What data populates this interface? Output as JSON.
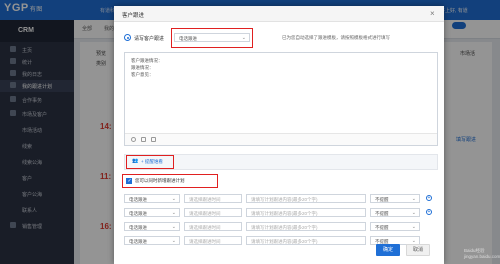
{
  "app": {
    "logo": "YGP",
    "logo_sub": "有图",
    "brand_note": "有道科技让营销变简单",
    "top_right": "牛上好, 有道"
  },
  "sidebar": {
    "title": "CRM",
    "items": [
      {
        "label": "主页"
      },
      {
        "label": "统计"
      },
      {
        "label": "我的日志"
      },
      {
        "label": "我的跟进计划"
      },
      {
        "label": "合作事务"
      },
      {
        "label": "市场及客户"
      },
      {
        "label": "市场活动"
      },
      {
        "label": "线索"
      },
      {
        "label": "线索公海"
      },
      {
        "label": "客户"
      },
      {
        "label": "客户公海"
      },
      {
        "label": "联系人"
      },
      {
        "label": "销售管理"
      }
    ]
  },
  "background": {
    "tab1": "全部",
    "tab2": "我的",
    "check1": "预览",
    "check2": "类别",
    "right_label": "市场活",
    "btn": "填写跟进",
    "times": [
      "14:",
      "11:",
      "16:"
    ]
  },
  "modal": {
    "title": "客户跟进",
    "close": "×",
    "template_label": "请写客户跟进",
    "template_select": "电话跟进",
    "template_hint": "已为您自动选择了跟进模板，请按照模板格式进行填写",
    "text_lines": [
      "客户跟进情况：",
      "跟进情况：",
      "客户意见："
    ],
    "mention_label": "+ 提醒谁看",
    "plan_checkbox_label": "您可以同时新增跟进计划",
    "plan_rows": [
      {
        "type": "电话跟进",
        "time_placeholder": "请选择跟进时间",
        "content_placeholder": "请填写计划跟进内容(最多20个字)",
        "remind": "不提醒"
      },
      {
        "type": "电话跟进",
        "time_placeholder": "请选择跟进时间",
        "content_placeholder": "请填写计划跟进内容(最多20个字)",
        "remind": "不提醒"
      },
      {
        "type": "电话跟进",
        "time_placeholder": "请选择跟进时间",
        "content_placeholder": "请填写计划跟进内容(最多20个字)",
        "remind": "不提醒"
      },
      {
        "type": "电话跟进",
        "time_placeholder": "请选择跟进时间",
        "content_placeholder": "请填写计划跟进内容(最多20个字)",
        "remind": "不提醒"
      }
    ],
    "ok_label": "确定",
    "cancel_label": "取消"
  },
  "watermark": "Baidu经验\njingyan.baidu.com",
  "colors": {
    "primary": "#1f6fd6",
    "highlight": "#e02020",
    "sidebar": "#2c3344"
  }
}
